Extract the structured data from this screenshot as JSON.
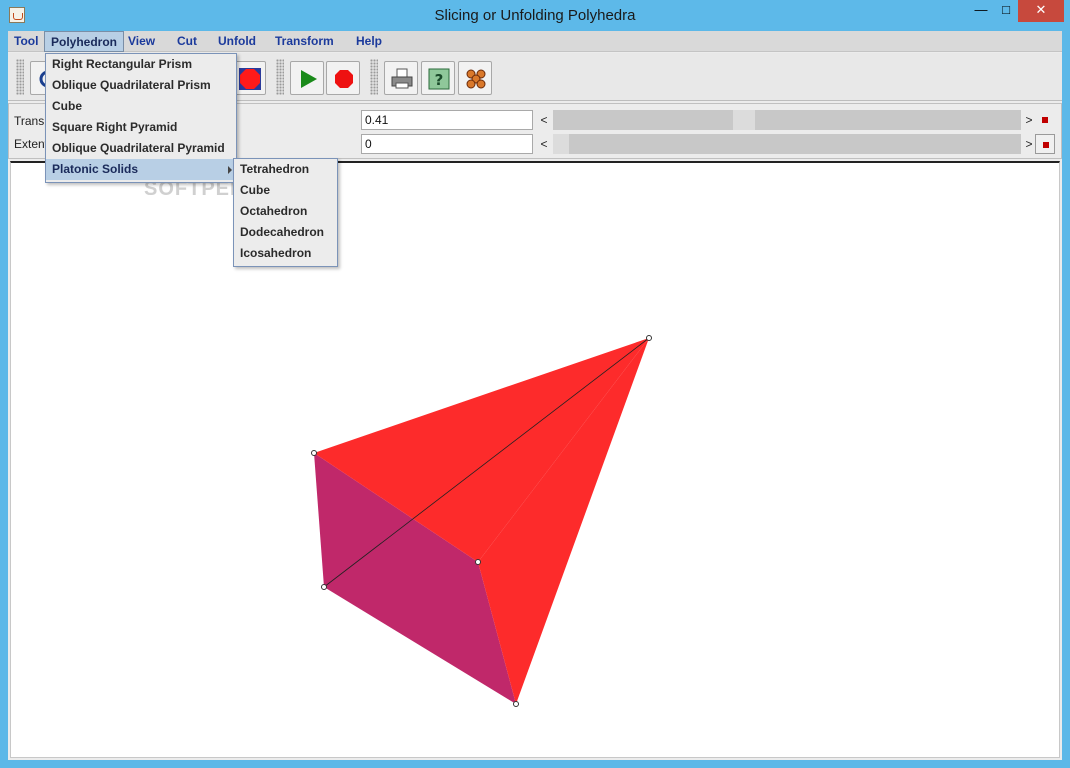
{
  "window": {
    "title": "Slicing or Unfolding Polyhedra",
    "minimize": "—",
    "maximize": "□",
    "close": "✕"
  },
  "menubar": [
    "Tool",
    "Polyhedron",
    "View",
    "Cut",
    "Unfold",
    "Transform",
    "Help"
  ],
  "polyhedron_menu": {
    "items": [
      "Right Rectangular Prism",
      "Oblique Quadrilateral Prism",
      "Cube",
      "Square Right Pyramid",
      "Oblique Quadrilateral Pyramid",
      "Platonic Solids"
    ],
    "highlighted": "Platonic Solids"
  },
  "platonic_submenu": [
    "Tetrahedron",
    "Cube",
    "Octahedron",
    "Dodecahedron",
    "Icosahedron"
  ],
  "toolbar": {
    "icons": [
      "rotate-icon",
      "octagon-icon",
      "play-icon",
      "stop-icon",
      "print-icon",
      "help-icon",
      "molecule-icon"
    ]
  },
  "params": {
    "transparency": {
      "label": "Trans",
      "value": "0.41",
      "left_arrow": "<",
      "right_arrow": ">"
    },
    "extent": {
      "label": "Extent",
      "value": "0",
      "left_arrow": "<",
      "right_arrow": ">"
    }
  },
  "watermark": "SOFTPEDIA",
  "colors": {
    "face_front": "#fd2b2b",
    "face_side": "#c0286a",
    "accent_menu": "#b8cfe5",
    "menu_text": "#1b3a9c"
  }
}
